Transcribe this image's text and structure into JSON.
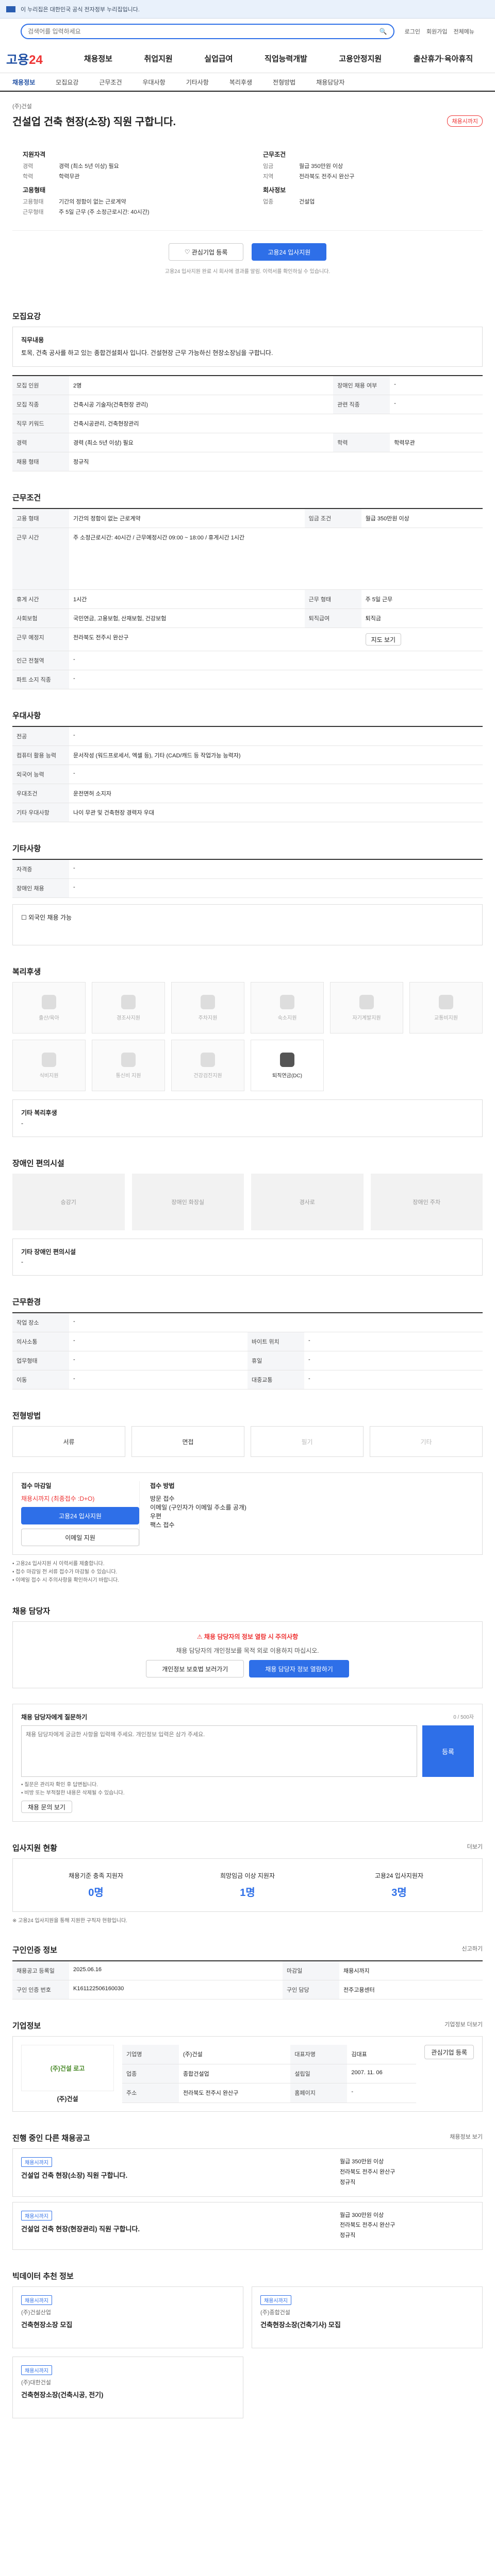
{
  "topbar": {
    "gov_text": "이 누리집은 대한민국 공식 전자정부 누리집입니다."
  },
  "search": {
    "placeholder": "검색어를 입력하세요",
    "links": [
      "로그인",
      "회원가입",
      "전체메뉴"
    ]
  },
  "gnb": {
    "logo_main": "고용",
    "logo_num": "24",
    "menu": [
      "채용정보",
      "취업지원",
      "실업급여",
      "직업능력개발",
      "고용안정지원",
      "출산휴가·육아휴직"
    ]
  },
  "tabs": [
    "채용정보",
    "모집요강",
    "근무조건",
    "우대사항",
    "기타사항",
    "복리후생",
    "전형방법",
    "채용담당자"
  ],
  "job": {
    "company": "(주)건설",
    "title": "건설업 건축 현장(소장) 직원 구합니다.",
    "dday": "채용시까지",
    "left_title": "지원자격",
    "left": [
      {
        "k": "경력",
        "v": "경력 (최소 5년 이상) 필요"
      },
      {
        "k": "학력",
        "v": "학력무관"
      }
    ],
    "left2_title": "고용형태",
    "left2": [
      {
        "k": "고용형태",
        "v": "기간의 정함이 없는 근로계약"
      },
      {
        "k": "근무형태",
        "v": "주 5일 근무 (주 소정근로시간: 40시간)"
      }
    ],
    "right_title": "근무조건",
    "right": [
      {
        "k": "임금",
        "v": "월급 350만원 이상"
      },
      {
        "k": "지역",
        "v": "전라북도 전주시 완산구"
      }
    ],
    "right2_title": "회사정보",
    "right2": [
      {
        "k": "업종",
        "v": "건설업"
      }
    ]
  },
  "actions": {
    "interest": "관심기업 등록",
    "apply": "고용24 입사지원",
    "note": "고용24 입사지원 완료 시 회사에 결과를 알림. 이력서를 확인하실 수 있습니다."
  },
  "recruit": {
    "title": "모집요강",
    "desc_label": "직무내용",
    "desc": "토목, 건축 공사를 하고 있는 종합건설회사 입니다. 건설현장 근무 가능하신 현장소장님을 구합니다.",
    "rows": [
      {
        "k": "모집 인원",
        "v": "2명",
        "k2": "장애인 채용 여부",
        "v2": "-"
      },
      {
        "k": "모집 직종",
        "v": "건축시공 기술자(건축현장 관리)",
        "k2": "관련 직종",
        "v2": "-"
      },
      {
        "k": "직무 키워드",
        "v": "건축시공관리, 건축현장관리",
        "k2": "",
        "v2": ""
      },
      {
        "k": "경력",
        "v": "경력 (최소 5년 이상) 필요",
        "k2": "학력",
        "v2": "학력무관"
      },
      {
        "k": "채용 형태",
        "v": "정규직",
        "k2": "",
        "v2": ""
      }
    ]
  },
  "conditions": {
    "title": "근무조건",
    "rows": [
      {
        "k": "고용 형태",
        "v": "기간의 정함이 없는 근로계약",
        "k2": "임금 조건",
        "v2": "월급 350만원 이상"
      },
      {
        "k": "근무 시간",
        "v": "주 소정근로시간: 40시간 / 근무예정시간 09:00 ~ 18:00 / 휴게시간 1시간",
        "k2": "",
        "v2": ""
      },
      {
        "k": "휴게 시간",
        "v": "1시간",
        "k2": "근무 형태",
        "v2": "주 5일 근무"
      },
      {
        "k": "사회보험",
        "v": "국민연금, 고용보험, 산재보험, 건강보험",
        "k2": "퇴직급여",
        "v2": "퇴직금"
      },
      {
        "k": "근무 예정지",
        "v": "전라북도 전주시 완산구",
        "k2": "",
        "v2": ""
      },
      {
        "k": "인근 전철역",
        "v": "-",
        "k2": "",
        "v2": ""
      },
      {
        "k": "파트 소지 직종",
        "v": "-",
        "k2": "",
        "v2": ""
      }
    ],
    "map_btn": "지도 보기"
  },
  "preference": {
    "title": "우대사항",
    "rows": [
      {
        "k": "전공",
        "v": "-"
      },
      {
        "k": "컴퓨터 활용 능력",
        "v": "문서작성 (워드프로세서, 엑셀 등), 기타 (CAD/캐드 등 작업가능 능력자)"
      },
      {
        "k": "외국어 능력",
        "v": "-"
      },
      {
        "k": "우대조건",
        "v": "운전면허 소지자"
      },
      {
        "k": "기타 우대사항",
        "v": "나이 무관 및 건축현장 경력자 우대"
      }
    ]
  },
  "etc": {
    "title": "기타사항",
    "rows": [
      {
        "k": "자격증",
        "v": "-"
      },
      {
        "k": "장애인 채용",
        "v": "-"
      }
    ],
    "check": "외국인 채용 가능"
  },
  "welfare": {
    "title": "복리후생",
    "items": [
      {
        "label": "출산/육아",
        "on": false
      },
      {
        "label": "경조사지원",
        "on": false
      },
      {
        "label": "주차지원",
        "on": false
      },
      {
        "label": "숙소지원",
        "on": false
      },
      {
        "label": "자기계발지원",
        "on": false
      },
      {
        "label": "교통비지원",
        "on": false
      },
      {
        "label": "식비지원",
        "on": false
      },
      {
        "label": "통신비 지원",
        "on": false
      },
      {
        "label": "건강검진지원",
        "on": false
      },
      {
        "label": "퇴직연금(DC)",
        "on": true
      }
    ],
    "etc_label": "기타 복리후생",
    "etc_value": "-"
  },
  "disabled": {
    "title": "장애인 편의시설",
    "items": [
      "승강기",
      "장애인 화장실",
      "경사로",
      "장애인 주차"
    ],
    "etc_label": "기타 장애인 편의시설",
    "etc_value": "-"
  },
  "worktype": {
    "title": "근무환경",
    "rows": [
      {
        "k": "작업 장소",
        "v": "-",
        "k2": "",
        "v2": ""
      },
      {
        "k": "의사소통",
        "v": "-",
        "k2": "바이트 위치",
        "v2": "-"
      },
      {
        "k": "업무형태",
        "v": "-",
        "k2": "휴일",
        "v2": "-"
      },
      {
        "k": "이동",
        "v": "-",
        "k2": "대중교통",
        "v2": "-"
      }
    ]
  },
  "selection": {
    "title": "전형방법",
    "methods": [
      {
        "label": "서류",
        "on": true
      },
      {
        "label": "면접",
        "on": true
      },
      {
        "label": "필기",
        "on": false
      },
      {
        "label": "기타",
        "on": false
      }
    ]
  },
  "apply": {
    "left_title": "접수 마감일",
    "left_value": "채용시까지 (최종접수 :D+O)",
    "apply_btn": "고용24 입사지원",
    "email_btn": "이메일 지원",
    "right_title": "접수 방법",
    "right_lines": [
      "방문 접수",
      "이메일 (구인자가 이메일 주소를 공개)",
      "우편",
      "팩스 접수"
    ],
    "notes": [
      "• 고용24 입사지원 시 이력서를 제출합니다.",
      "• 접수 마감일 전 서류 접수가 마감될 수 있습니다.",
      "• 이메일 접수 시 주의사항을 확인하시기 바랍니다."
    ]
  },
  "contact": {
    "title": "채용 담당자",
    "warn": "채용 담당자의 정보 열람 시 주의사항",
    "warn_desc": "채용 담당자의 개인정보를 목적 외로 이용하지 마십시오.",
    "btn1": "개인정보 보호법 보러가기",
    "btn2": "채용 담당자 정보 열람하기"
  },
  "question": {
    "title": "채용 담당자에게 질문하기",
    "count": "0 / 500자",
    "placeholder": "채용 담당자에게 궁금한 사항을 입력해 주세요. 개인정보 입력은 삼가 주세요.",
    "submit": "등록",
    "notes": [
      "• 질문은 관리자 확인 후 답변됩니다.",
      "• 비방 또는 부적절한 내용은 삭제될 수 있습니다."
    ],
    "more_btn": "채용 문의 보기"
  },
  "stats": {
    "title": "입사지원 현황",
    "more": "더보기",
    "items": [
      {
        "label": "채용기준 충족 지원자",
        "value": "0명"
      },
      {
        "label": "희망임금 이상 지원자",
        "value": "1명"
      },
      {
        "label": "고용24 입사지원자",
        "value": "3명"
      }
    ],
    "note": "※ 고용24 입사지원을 통해 지원한 구직자 현황입니다."
  },
  "meta": {
    "title": "구인인증 정보",
    "rows": [
      {
        "k": "채용공고 등록일",
        "v": "2025.06.16",
        "k2": "마감일",
        "v2": "채용시까지"
      },
      {
        "k": "구인 인증 번호",
        "v": "K161122506160030",
        "k2": "구인 담당",
        "v2": "전주고용센터"
      }
    ],
    "btn": "신고하기"
  },
  "company": {
    "title": "기업정보",
    "more": "기업정보 더보기",
    "logo": "(주)건설 로고",
    "name": "(주)건설",
    "rows": [
      {
        "k": "기업명",
        "v": "(주)건설",
        "k2": "대표자명",
        "v2": "김대표"
      },
      {
        "k": "업종",
        "v": "종합건설업",
        "k2": "설립일",
        "v2": "2007. 11. 06"
      },
      {
        "k": "주소",
        "v": "전라북도 전주시 완산구",
        "k2": "홈페이지",
        "v2": "-"
      }
    ],
    "follow": "관심기업 등록"
  },
  "similar": {
    "title": "진행 중인 다른 채용공고",
    "more": "채용정보 보기",
    "items": [
      {
        "tag": "채용시까지",
        "title": "건설업 건축 현장(소장) 직원 구합니다.",
        "salary": "월급 350만원 이상",
        "place": "전라북도 전주시 완산구",
        "type": "정규직"
      },
      {
        "tag": "채용시까지",
        "title": "건설업 건축 현장(현장관리) 직원 구합니다.",
        "salary": "월급 300만원 이상",
        "place": "전라북도 전주시 완산구",
        "type": "정규직"
      }
    ]
  },
  "recommend": {
    "title": "빅데이터 추천 정보",
    "items": [
      {
        "tag": "채용시까지",
        "company": "(주)건설산업",
        "title": "건축현장소장 모집"
      },
      {
        "tag": "채용시까지",
        "company": "(주)종합건설",
        "title": "건축현장소장(건축기사) 모집"
      },
      {
        "tag": "채용시까지",
        "company": "(주)대한건설",
        "title": "건축현장소장(건축시공, 전기)"
      }
    ]
  }
}
